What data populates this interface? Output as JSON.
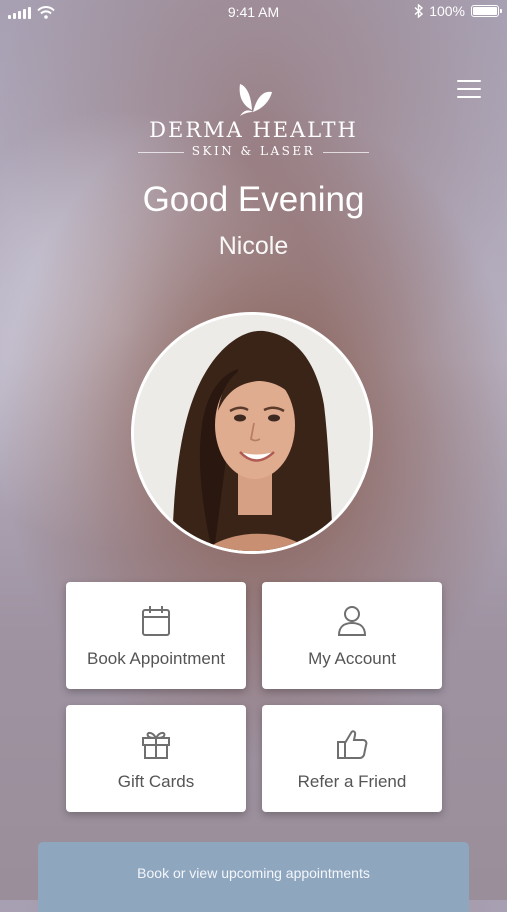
{
  "status_bar": {
    "time": "9:41 AM",
    "battery": "100%"
  },
  "brand": {
    "name": "DERMA HEALTH",
    "tagline": "SKIN & LASER"
  },
  "greeting": {
    "title": "Good Evening",
    "name": "Nicole"
  },
  "tiles": [
    {
      "label": "Book Appointment",
      "icon": "calendar-icon"
    },
    {
      "label": "My Account",
      "icon": "user-icon"
    },
    {
      "label": "Gift Cards",
      "icon": "gift-icon"
    },
    {
      "label": "Refer a Friend",
      "icon": "thumbs-up-icon"
    }
  ],
  "footer": {
    "label": "Book or view upcoming appointments"
  },
  "colors": {
    "footer_bar": "#8fa6bf",
    "tile_icon": "#6f6f6f"
  }
}
